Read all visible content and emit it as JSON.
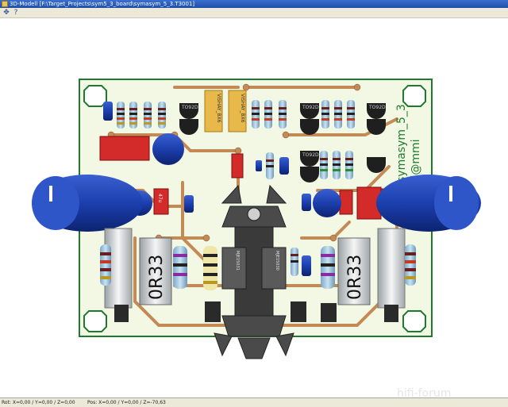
{
  "window": {
    "title": "3D-Modell [F:\\Target_Projects\\sym5_3_board\\symasym_5_3.T3001]"
  },
  "toolbar": {
    "icons": [
      "move-icon",
      "help-icon"
    ]
  },
  "board": {
    "brand_text": "symasym_5_3",
    "brand_text2": "ti@mmi",
    "resistor_label_left": "0R33",
    "resistor_label_right": "0R33",
    "cap_label_1": "VISHAY_BX6",
    "cap_label_2": "VISHAY_BX6",
    "transistor_label": "TO92D",
    "power_label_left": "MJE15031",
    "power_label_right": "MJE15030",
    "cap_small_label": "47u"
  },
  "status": {
    "rot": "Rot: X=0,00 / Y=0,00 / Z=0,00",
    "pos": "Pos: X=0,00 / Y=0,00 / Z=-70,63"
  },
  "watermark": "hifi-forum",
  "colors": {
    "board": "#f2f8e4",
    "copper": "#c48a55",
    "silk": "#1e7a2e",
    "capacitor": "#1c3fae"
  }
}
